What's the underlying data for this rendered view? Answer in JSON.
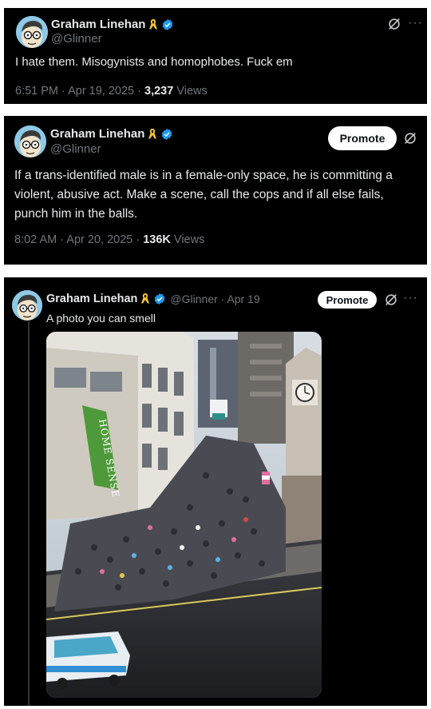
{
  "tweets": [
    {
      "name": "Graham Linehan",
      "handle": "@Glinner",
      "text": "I hate them. Misogynists and homophobes. Fuck em",
      "time": "6:51 PM · Apr 19, 2025 · ",
      "views_count": "3,237",
      "views_label": " Views"
    },
    {
      "name": "Graham Linehan",
      "handle": "@Glinner",
      "promote_label": "Promote",
      "text_lines": [
        "If a trans-identified male is in a female-only space, he is committing a",
        "violent, abusive act. Make a scene, call the cops and if all else fails,",
        "punch him in the balls."
      ],
      "time": "8:02 AM · Apr 20, 2025 · ",
      "views_count": "136K",
      "views_label": " Views"
    },
    {
      "name": "Graham Linehan",
      "handle_date": "@Glinner · Apr 19",
      "promote_label": "Promote",
      "text": "A photo you can smell",
      "photo": {
        "sign_text": "HOME SENSE"
      }
    }
  ],
  "colors": {
    "background": "#000000",
    "verified": "#1d9bf0",
    "ribbon": "#f4c430",
    "muted": "#71767b"
  },
  "icons": [
    "avatar",
    "awareness-ribbon-icon",
    "verified-badge-icon",
    "grok-icon",
    "more-icon"
  ]
}
